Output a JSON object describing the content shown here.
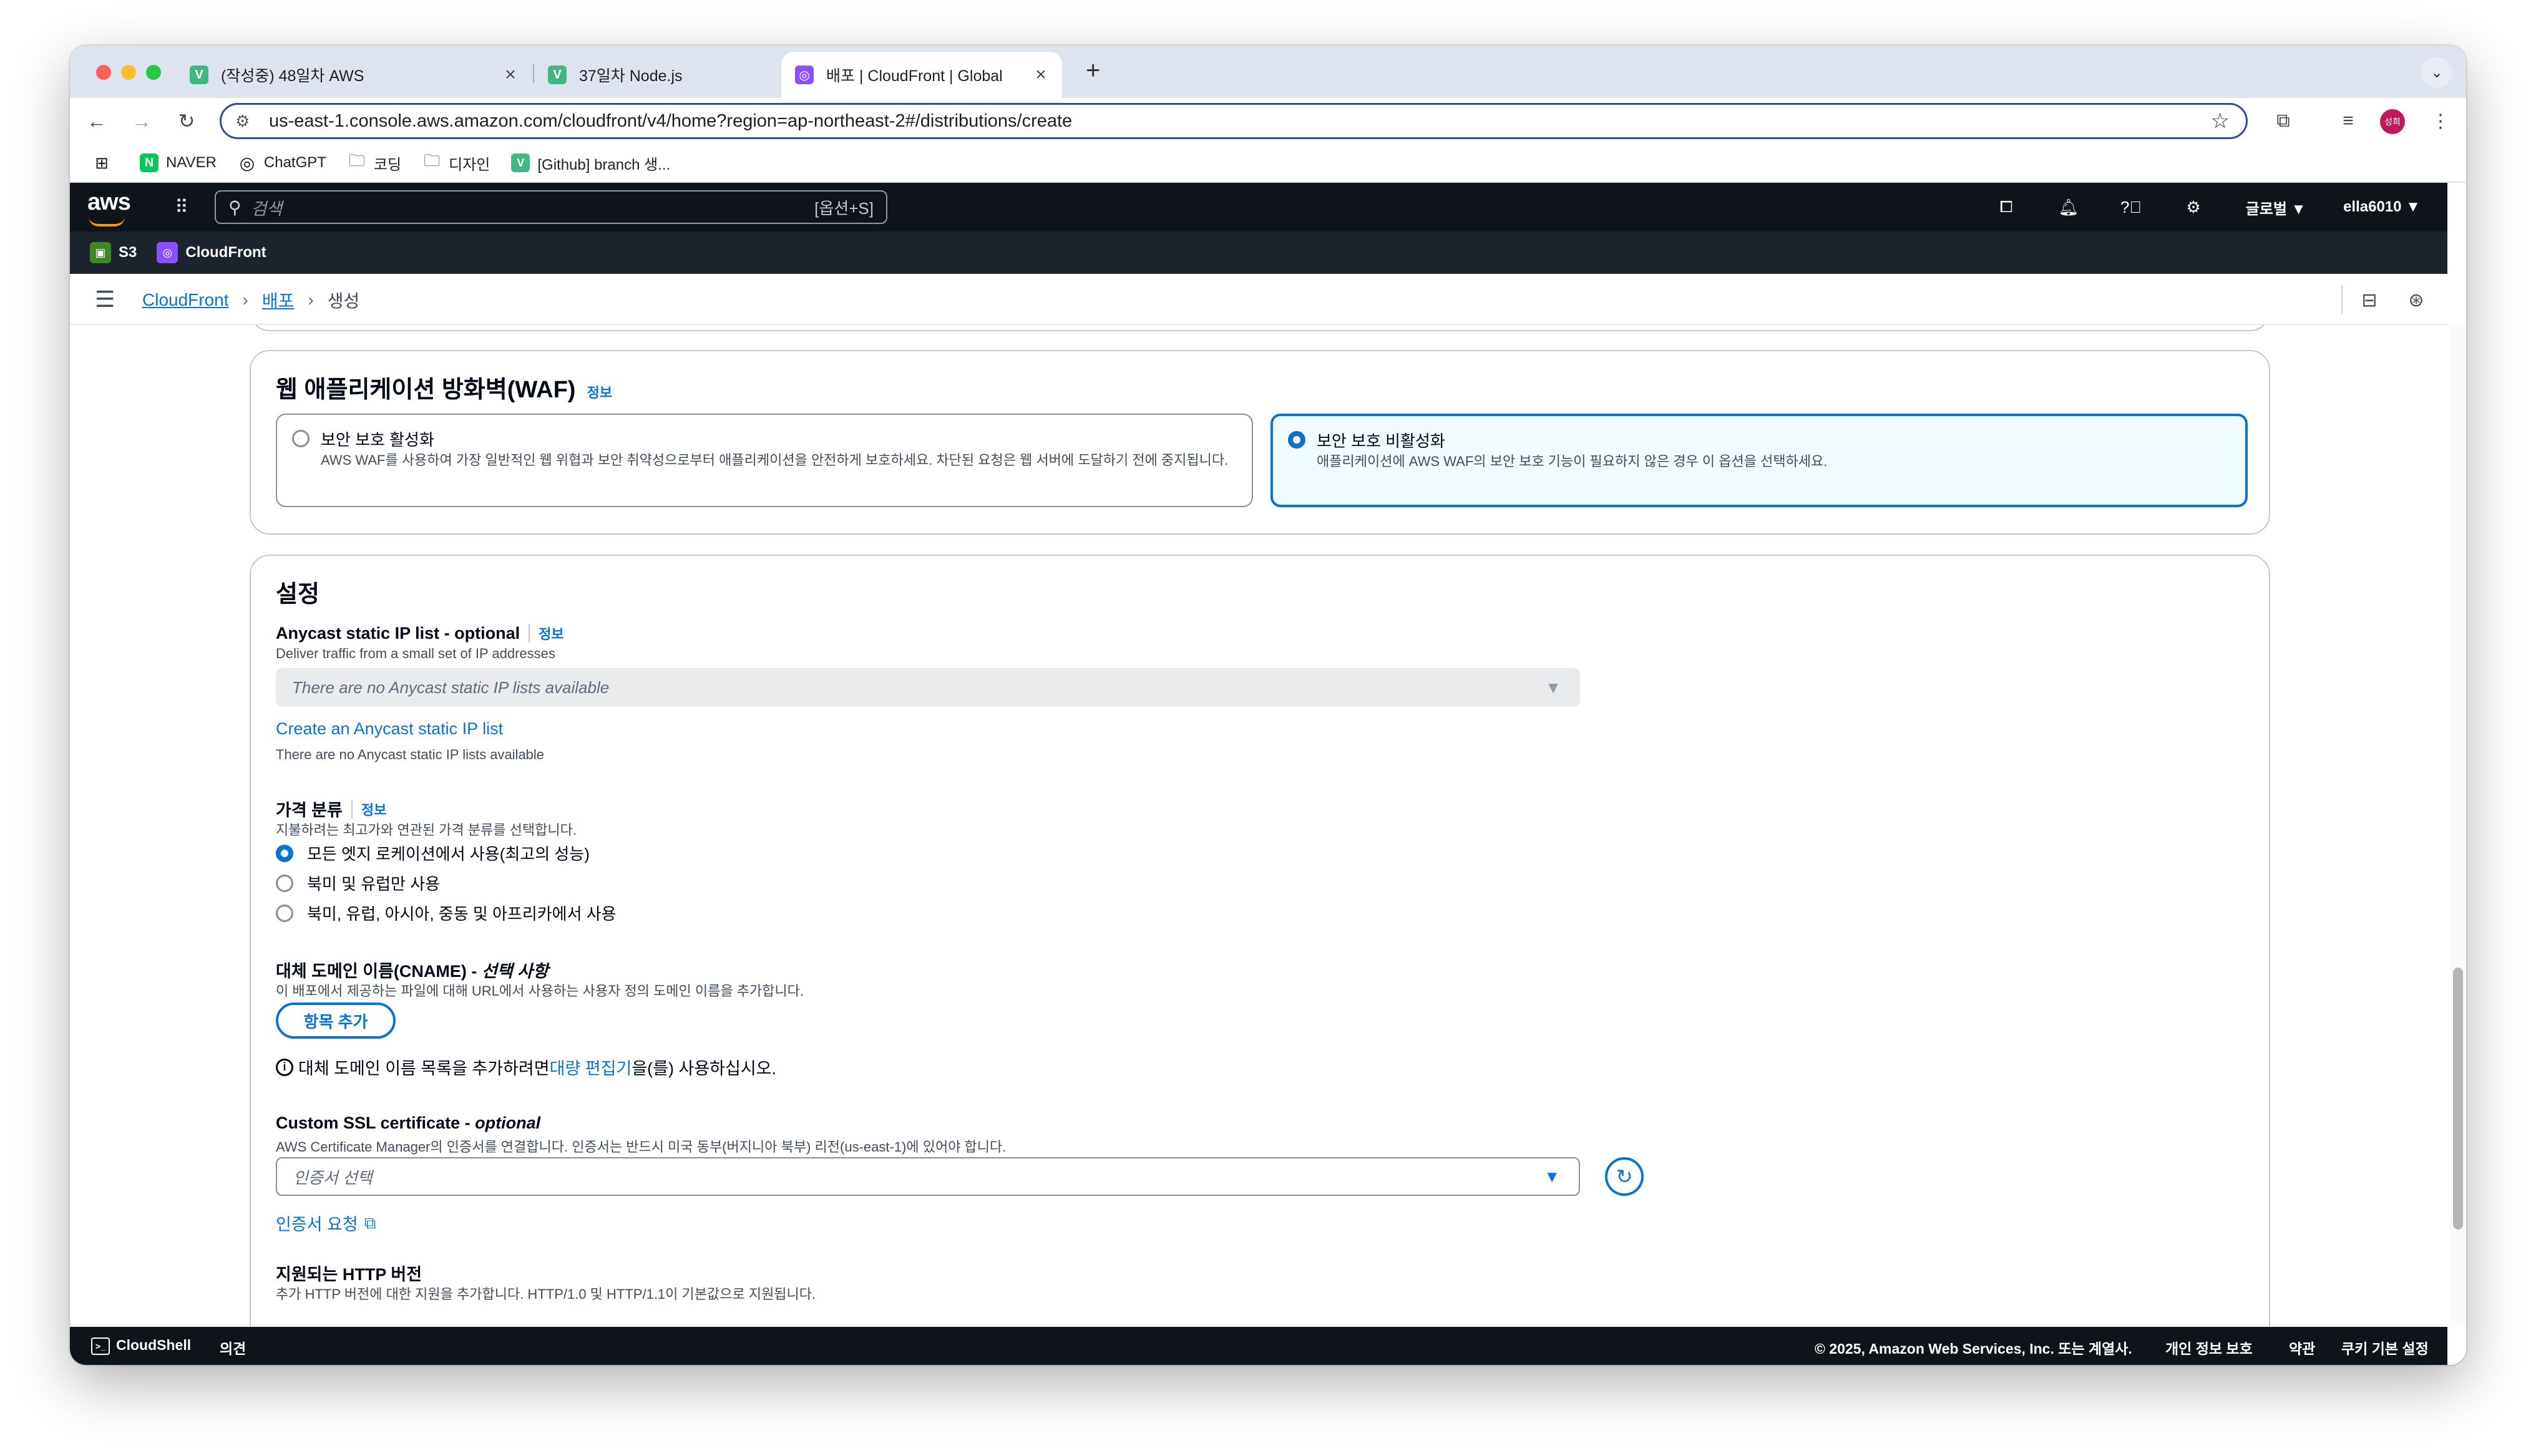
{
  "browser": {
    "tabs": [
      {
        "title": "(작성중) 48일차 AWS",
        "favicon": "V",
        "active": false
      },
      {
        "title": "37일차 Node.js",
        "favicon": "V",
        "active": false
      },
      {
        "title": "배포 | CloudFront | Global",
        "favicon": "cloudfront-icon",
        "active": true
      }
    ],
    "url": "us-east-1.console.aws.amazon.com/cloudfront/v4/home?region=ap-northeast-2#/distributions/create",
    "profile_badge": "성희",
    "bookmarks": [
      {
        "label": "NAVER",
        "icon": "N"
      },
      {
        "label": "ChatGPT",
        "icon": "chatgpt-icon"
      },
      {
        "label": "코딩",
        "icon": "folder-icon"
      },
      {
        "label": "디자인",
        "icon": "folder-icon"
      },
      {
        "label": "[Github] branch 생...",
        "icon": "V"
      }
    ]
  },
  "aws": {
    "logo": "aws",
    "search_placeholder": "검색",
    "search_shortcut": "[옵션+S]",
    "region": "글로벌 ▼",
    "account": "ella6010 ▼",
    "services": [
      "S3",
      "CloudFront"
    ],
    "breadcrumb": [
      "CloudFront",
      "배포",
      "생성"
    ]
  },
  "waf": {
    "title": "웹 애플리케이션 방화벽(WAF)",
    "info": "정보",
    "options": [
      {
        "label": "보안 보호 활성화",
        "desc": "AWS WAF를 사용하여 가장 일반적인 웹 위협과 보안 취약성으로부터 애플리케이션을 안전하게 보호하세요. 차단된 요청은 웹 서버에 도달하기 전에 중지됩니다.",
        "selected": false
      },
      {
        "label": "보안 보호 비활성화",
        "desc": "애플리케이션에 AWS WAF의 보안 보호 기능이 필요하지 않은 경우 이 옵션을 선택하세요.",
        "selected": true
      }
    ]
  },
  "settings": {
    "title": "설정",
    "anycast": {
      "label": "Anycast static IP list - optional",
      "info": "정보",
      "desc": "Deliver traffic from a small set of IP addresses",
      "select_value": "There are no Anycast static IP lists available",
      "create_link": "Create an Anycast static IP list",
      "note": "There are no Anycast static IP lists available"
    },
    "price_class": {
      "label": "가격 분류",
      "info": "정보",
      "desc": "지불하려는 최고가와 연관된 가격 분류를 선택합니다.",
      "options": [
        {
          "label": "모든 엣지 로케이션에서 사용(최고의 성능)",
          "selected": true
        },
        {
          "label": "북미 및 유럽만 사용",
          "selected": false
        },
        {
          "label": "북미, 유럽, 아시아, 중동 및 아프리카에서 사용",
          "selected": false
        }
      ]
    },
    "cname": {
      "label": "대체 도메인 이름(CNAME) - ",
      "label_optional": "선택 사항",
      "desc": "이 배포에서 제공하는 파일에 대해 URL에서 사용하는 사용자 정의 도메인 이름을 추가합니다.",
      "add_button": "항목 추가",
      "bulk_prefix": "대체 도메인 이름 목록을 추가하려면 ",
      "bulk_link": "대량 편집기",
      "bulk_suffix": "을(를) 사용하십시오."
    },
    "ssl": {
      "label": "Custom SSL certificate - ",
      "label_optional": "optional",
      "desc": "AWS Certificate Manager의 인증서를 연결합니다. 인증서는 반드시 미국 동부(버지니아 북부) 리전(us-east-1)에 있어야 합니다.",
      "select_placeholder": "인증서 선택",
      "request_link": "인증서 요청"
    },
    "http": {
      "label": "지원되는 HTTP 버전",
      "desc": "추가 HTTP 버전에 대한 지원을 추가합니다. HTTP/1.0 및 HTTP/1.1이 기본값으로 지원됩니다."
    }
  },
  "footer": {
    "cloudshell": "CloudShell",
    "feedback": "의견",
    "copyright": "© 2025, Amazon Web Services, Inc. 또는 계열사.",
    "privacy": "개인 정보 보호",
    "terms": "약관",
    "cookies": "쿠키 기본 설정"
  },
  "colors": {
    "aws_nav": "#0f141a",
    "service_bar": "#1b232d",
    "link_blue": "#0972d3",
    "selected_tile_bg": "#f0fbff"
  }
}
